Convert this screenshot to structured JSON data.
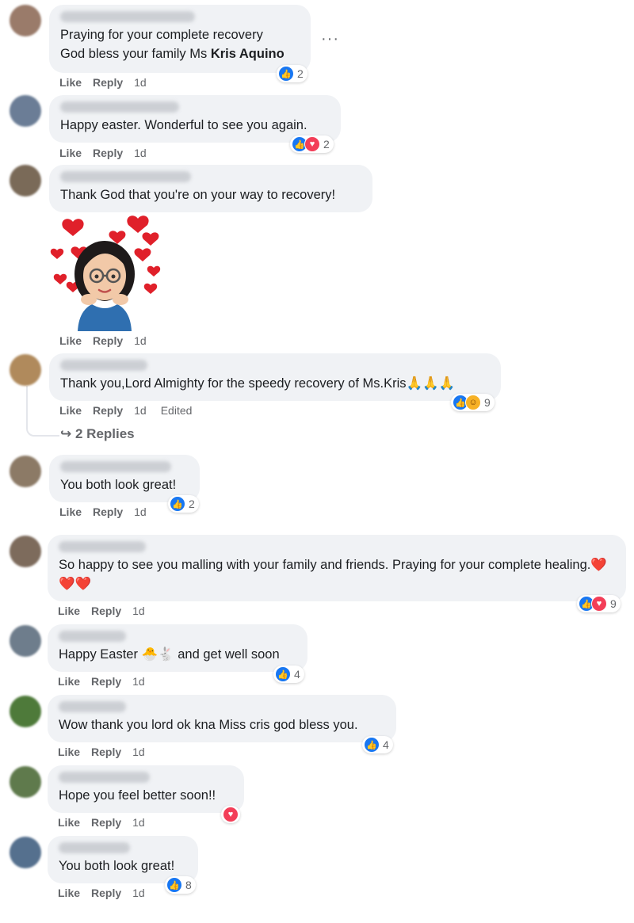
{
  "actions": {
    "like": "Like",
    "reply": "Reply"
  },
  "comments": [
    {
      "text_pre": "Praying for your complete recovery\nGod bless your family Ms ",
      "mention": "Kris Aquino",
      "time": "1d",
      "reactions": "2"
    },
    {
      "text": "Happy easter. Wonderful to see you again.",
      "time": "1d",
      "reactions": "2"
    },
    {
      "text": "Thank God that you're on your way to recovery!",
      "time": "1d"
    },
    {
      "text": "Thank you,Lord Almighty for the speedy recovery of Ms.Kris🙏🙏🙏",
      "time": "1d",
      "edited": "Edited",
      "reactions": "9",
      "replies": "2 Replies"
    },
    {
      "text": "You both look great!",
      "time": "1d",
      "reactions": "2"
    },
    {
      "text": "So happy to see you malling with your family and friends. Praying for your complete healing.❤️❤️❤️",
      "time": "1d",
      "reactions": "9"
    },
    {
      "text": "Happy Easter 🐣🐇 and get well soon",
      "time": "1d",
      "reactions": "4"
    },
    {
      "text": "Wow thank you lord ok kna Miss cris god bless you.",
      "time": "1d",
      "reactions": "4"
    },
    {
      "text": "Hope you feel better soon!!",
      "time": "1d"
    },
    {
      "text": "You both look great!",
      "time": "1d",
      "reactions": "8"
    }
  ],
  "colors": {
    "like": "#1877f2",
    "love": "#f33e58",
    "care": "#f7b125",
    "bubble": "#f0f2f5",
    "meta": "#65676b"
  },
  "icons": {
    "more": "more-options-icon",
    "reply_arrow": "reply-arrow-icon"
  },
  "glyphs": {
    "more": "···",
    "reply_arrow": "↪"
  }
}
